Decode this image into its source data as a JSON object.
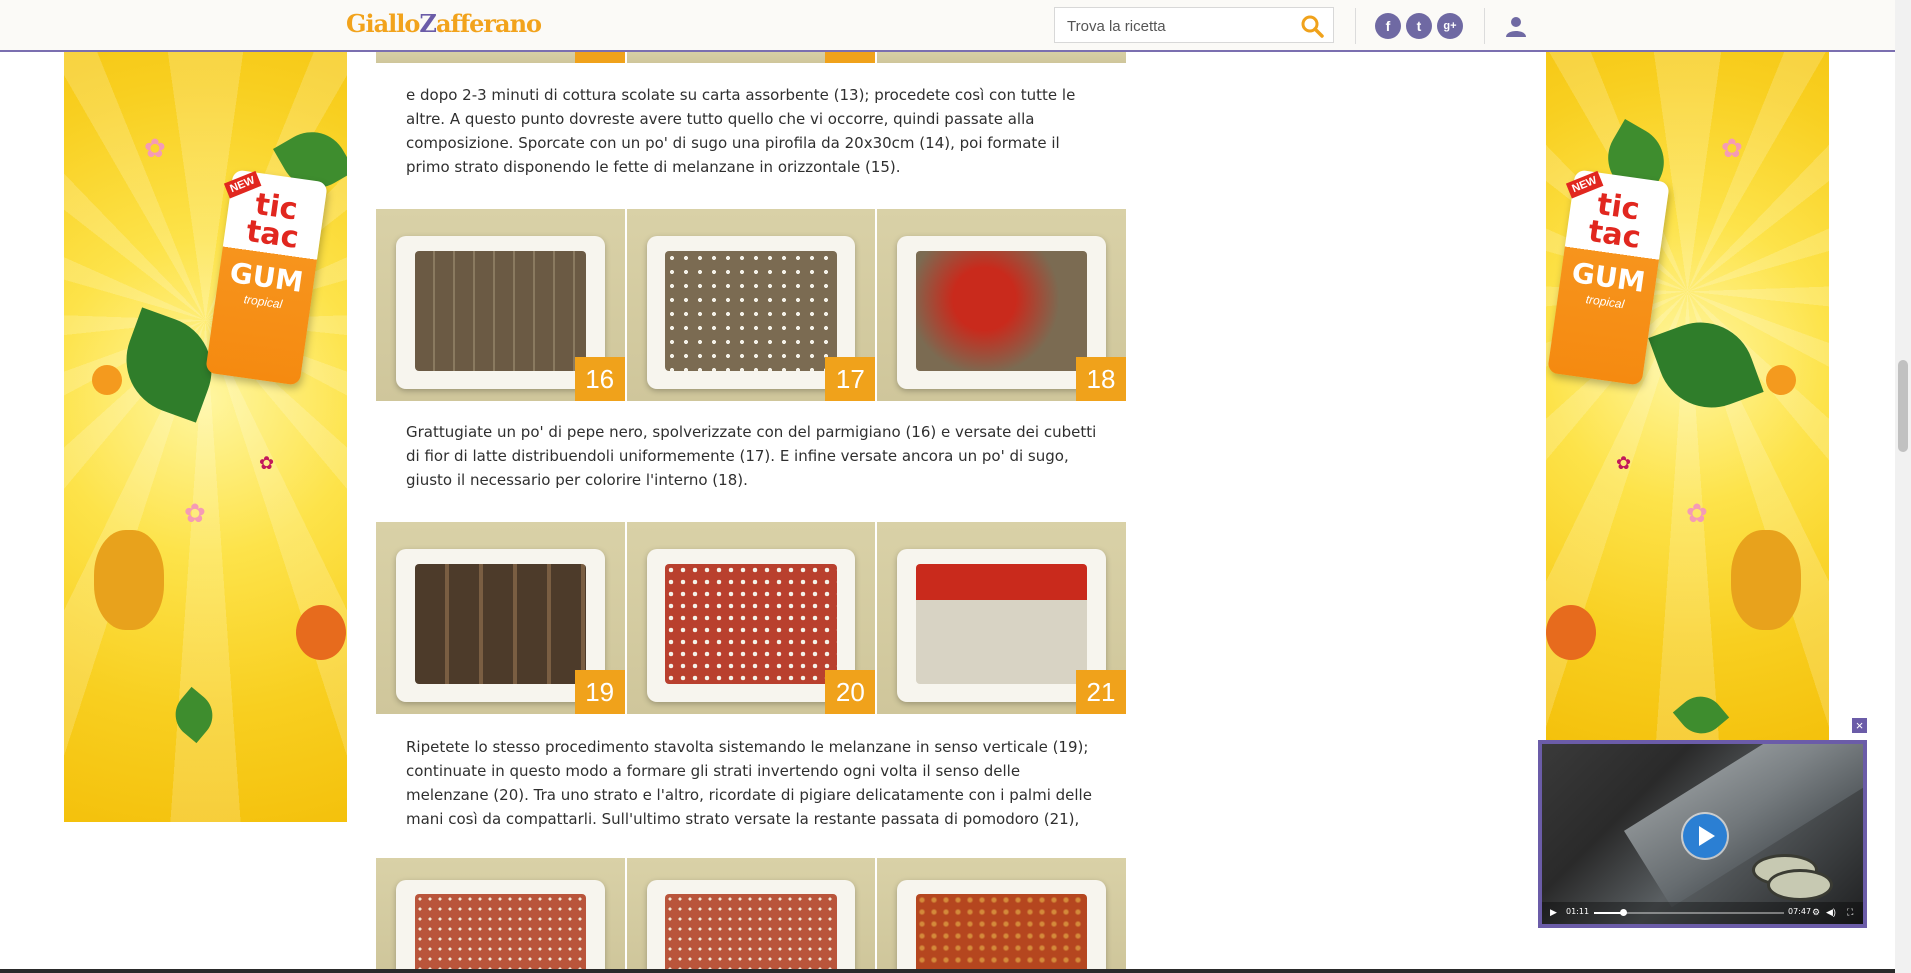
{
  "header": {
    "logo_left": "Giallo",
    "logo_z": "Z",
    "logo_right": "afferano",
    "search_placeholder": "Trova la ricetta",
    "social": {
      "facebook": "f",
      "twitter": "t",
      "google": "g+"
    }
  },
  "colors": {
    "brand_orange": "#f0a21b",
    "brand_purple": "#6b5ca8",
    "ad_yellow": "#f8cf20"
  },
  "icons": [
    "search-icon",
    "facebook-icon",
    "twitter-icon",
    "googleplus-icon",
    "user-icon",
    "play-icon",
    "close-icon",
    "volume-icon",
    "settings-icon",
    "fullscreen-icon"
  ],
  "ad": {
    "new": "NEW",
    "brand": "tic tac",
    "product": "GUM",
    "flavor": "tropical"
  },
  "steps": {
    "top": [
      "",
      "",
      ""
    ],
    "strip1": [
      "16",
      "17",
      "18"
    ],
    "strip2": [
      "19",
      "20",
      "21"
    ],
    "strip3": [
      "",
      "",
      ""
    ]
  },
  "paragraphs": [
    "e dopo 2-3 minuti di cottura scolate su carta assorbente (13); procedete così con tutte le altre. A questo punto dovreste avere tutto quello che vi occorre, quindi passate alla composizione. Sporcate con un po' di sugo una pirofila da 20x30cm (14), poi formate il primo strato disponendo le fette di melanzane in orizzontale (15).",
    "Grattugiate un po' di pepe nero, spolverizzate con del parmigiano (16) e versate dei cubetti di fior di latte distribuendoli uniformemente (17). E infine versate ancora un po' di sugo, giusto il necessario per colorire l'interno (18).",
    "Ripetete lo stesso procedimento stavolta sistemando le melanzane in senso verticale (19); continuate in questo modo a formare gli strati invertendo ogni volta il senso delle melenzane (20). Tra uno strato e l'altro, ricordate di pigiare delicatamente con i palmi delle mani così da compattarli. Sull'ultimo strato versate la restante passata di pomodoro (21),"
  ],
  "video": {
    "current_time": "01:11",
    "duration": "07:47",
    "progress": 0.15
  }
}
